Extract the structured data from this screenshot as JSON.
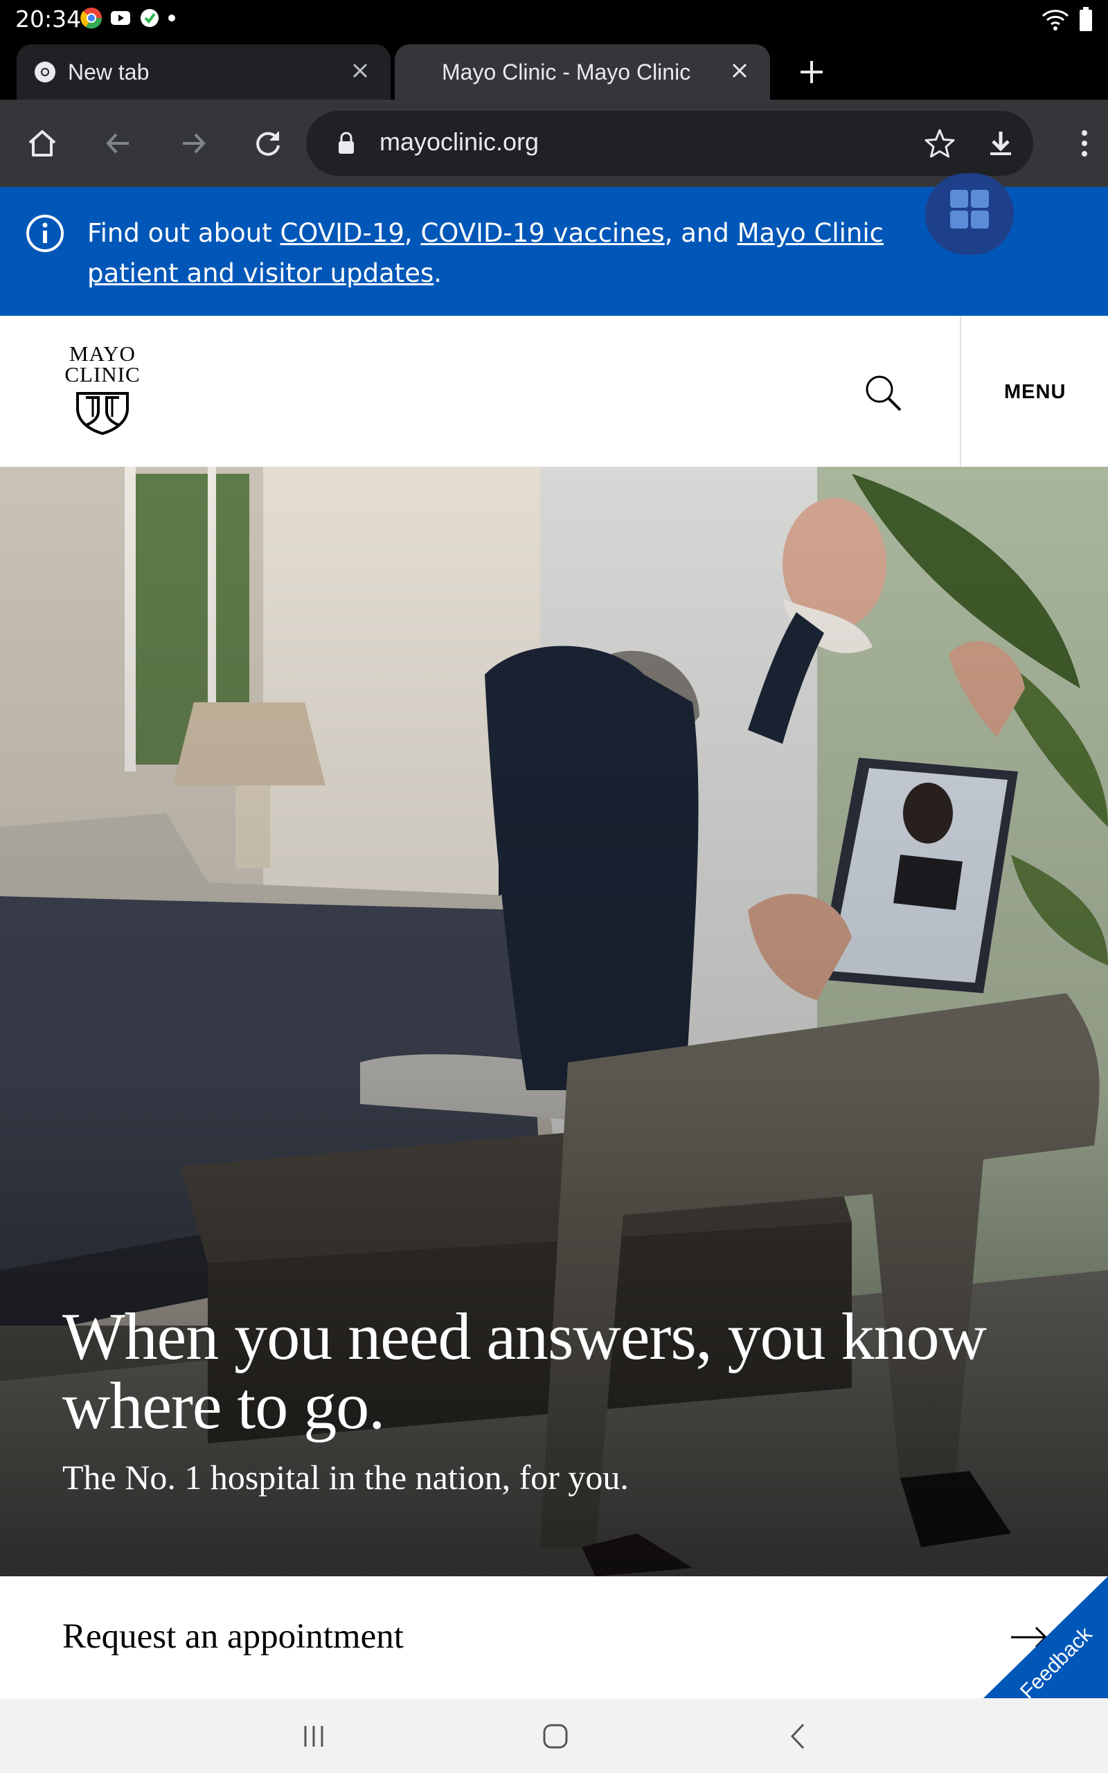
{
  "status_bar": {
    "time": "20:34"
  },
  "tabs": [
    {
      "title": "New tab"
    },
    {
      "title": "Mayo Clinic - Mayo Clinic"
    }
  ],
  "omnibox": {
    "url": "mayoclinic.org"
  },
  "alert": {
    "prefix": "Find out about ",
    "link1": "COVID-19",
    "sep1": ", ",
    "link2": "COVID-19 vaccines",
    "sep2": ", and ",
    "link3": "Mayo Clinic patient and visitor updates",
    "suffix": "."
  },
  "header": {
    "logo_line1": "MAYO",
    "logo_line2": "CLINIC",
    "menu_label": "MENU"
  },
  "hero": {
    "headline": "When you need answers, you know where to go.",
    "subline": "The No. 1 hospital in the nation, for you."
  },
  "appointment": {
    "label": "Request an appointment"
  },
  "feedback": {
    "label": "Feedback"
  },
  "colors": {
    "alert_bg": "#0057b8",
    "feedback_bg": "#0057b8",
    "toolbar_bg": "#35363a"
  }
}
